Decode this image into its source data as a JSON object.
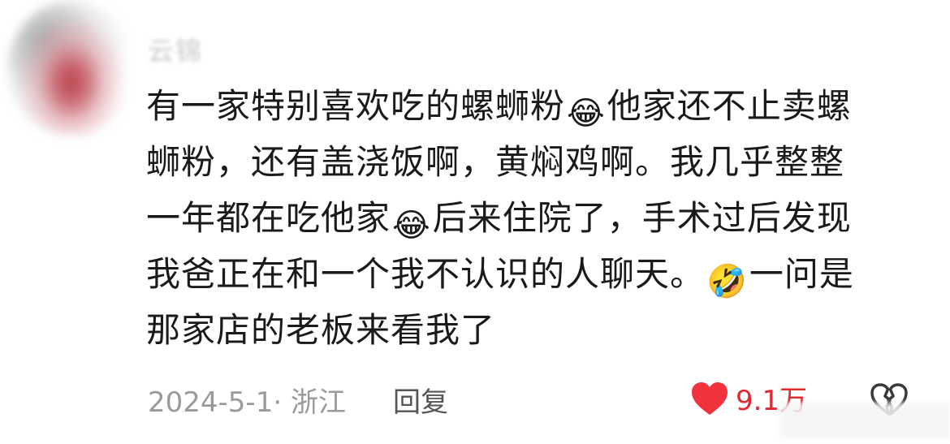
{
  "comment": {
    "username": "云锦",
    "lines": [
      {
        "text_a": "有一家特别喜欢吃的螺蛳粉",
        "emoji": "😂",
        "text_b": "他家还不止卖螺"
      },
      {
        "text_a": "蛳粉，还有盖浇饭啊，黄焖鸡啊。我几乎整整",
        "emoji": "",
        "text_b": ""
      },
      {
        "text_a": "一年都在吃他家",
        "emoji": "😂",
        "text_b": "后来住院了，手术过后发现"
      },
      {
        "text_a": "我爸正在和一个我不认识的人聊天。",
        "emoji": "🤣",
        "text_b": "一问是"
      },
      {
        "text_a": "那家店的老板来看我了",
        "emoji": "",
        "text_b": ""
      }
    ],
    "meta": {
      "date_location": "2024-5-1· 浙江",
      "reply_label": "回复"
    },
    "like": {
      "count": "9.1万",
      "icon": "heart-icon",
      "color": "#f0323c"
    },
    "dislike_icon": "broken-heart-outline-icon"
  }
}
